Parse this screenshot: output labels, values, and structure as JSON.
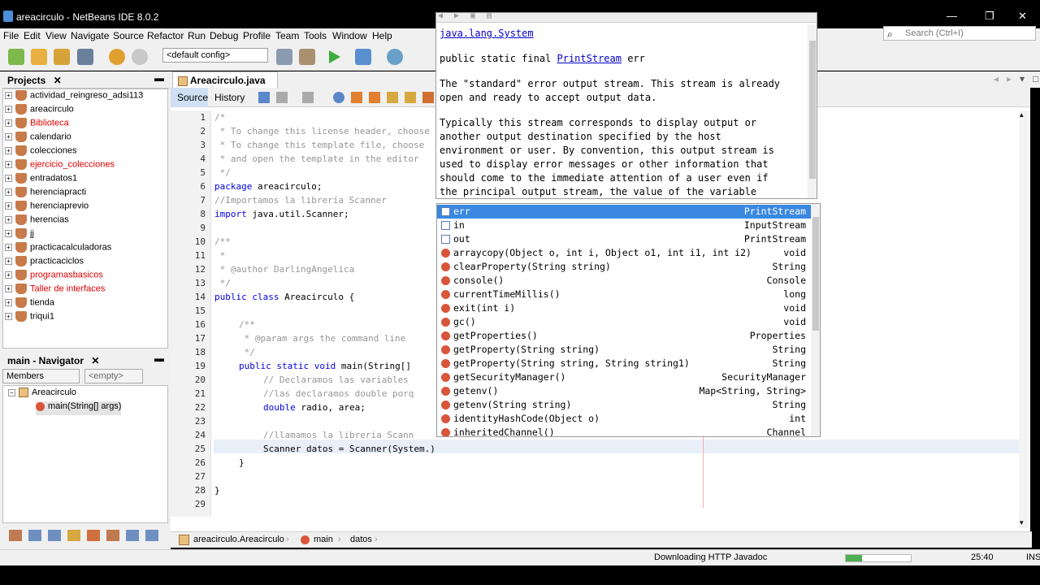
{
  "window": {
    "title": "areacirculo - NetBeans IDE 8.0.2"
  },
  "menu": [
    "File",
    "Edit",
    "View",
    "Navigate",
    "Source",
    "Refactor",
    "Run",
    "Debug",
    "Profile",
    "Team",
    "Tools",
    "Window",
    "Help"
  ],
  "toolbar": {
    "config": "<default config>",
    "search_placeholder": "Search (Ctrl+I)"
  },
  "projects": {
    "title": "Projects",
    "items": [
      {
        "label": "actividad_reingreso_adsi113",
        "error": false
      },
      {
        "label": "areacirculo",
        "error": false
      },
      {
        "label": "Biblioteca",
        "error": true
      },
      {
        "label": "calendario",
        "error": false
      },
      {
        "label": "colecciones",
        "error": false
      },
      {
        "label": "ejercicio_colecciones",
        "error": true
      },
      {
        "label": "entradatos1",
        "error": false
      },
      {
        "label": "herenciapracti",
        "error": false
      },
      {
        "label": "herenciaprevio",
        "error": false
      },
      {
        "label": "herencias",
        "error": false
      },
      {
        "label": "jj",
        "error": false
      },
      {
        "label": "practicacalculadoras",
        "error": false
      },
      {
        "label": "practicaciclos",
        "error": false
      },
      {
        "label": "programasbasicos",
        "error": true
      },
      {
        "label": "Taller de interfaces",
        "error": true
      },
      {
        "label": "tienda",
        "error": false
      },
      {
        "label": "triqui1",
        "error": false
      }
    ]
  },
  "navigator": {
    "title": "main - Navigator",
    "filter": "Members",
    "empty": "<empty>",
    "class": "Areacirculo",
    "method": "main(String[] args)"
  },
  "editor": {
    "tab": "Areacirculo.java",
    "source": "Source",
    "history": "History",
    "lines": [
      {
        "n": "1",
        "text": "/*",
        "cls": "cm",
        "indent": 0
      },
      {
        "n": "2",
        "text": " * To change this license header, choose",
        "cls": "cm",
        "indent": 0
      },
      {
        "n": "3",
        "text": " * To change this template file, choose",
        "cls": "cm",
        "indent": 0
      },
      {
        "n": "4",
        "text": " * and open the template in the editor",
        "cls": "cm",
        "indent": 0
      },
      {
        "n": "5",
        "text": " */",
        "cls": "cm",
        "indent": 0
      },
      {
        "n": "6",
        "text": "package areacirculo;",
        "cls": "",
        "indent": 0
      },
      {
        "n": "7",
        "text": "//Importamos la librería Scanner",
        "cls": "cm",
        "indent": 0
      },
      {
        "n": "8",
        "text": "import java.util.Scanner;",
        "cls": "",
        "indent": 0
      },
      {
        "n": "9",
        "text": "",
        "cls": "",
        "indent": 0
      },
      {
        "n": "10",
        "text": "/**",
        "cls": "cm",
        "indent": 0
      },
      {
        "n": "11",
        "text": " *",
        "cls": "cm",
        "indent": 0
      },
      {
        "n": "12",
        "text": " * @author DarlingAngelica",
        "cls": "cm",
        "indent": 0
      },
      {
        "n": "13",
        "text": " */",
        "cls": "cm",
        "indent": 0
      },
      {
        "n": "14",
        "text": "public class Areacirculo {",
        "cls": "",
        "indent": 0
      },
      {
        "n": "15",
        "text": "",
        "cls": "",
        "indent": 0
      },
      {
        "n": "16",
        "text": "/**",
        "cls": "cm",
        "indent": 1
      },
      {
        "n": "17",
        "text": " * @param args the command line",
        "cls": "cm",
        "indent": 1
      },
      {
        "n": "18",
        "text": " */",
        "cls": "cm",
        "indent": 1
      },
      {
        "n": "19",
        "text": "public static void main(String[]",
        "cls": "",
        "indent": 1
      },
      {
        "n": "20",
        "text": "// Declaramos las variables",
        "cls": "cm",
        "indent": 2
      },
      {
        "n": "21",
        "text": "//las declaramos double porq",
        "cls": "cm",
        "indent": 2
      },
      {
        "n": "22",
        "text": "double radio, area;",
        "cls": "",
        "indent": 2
      },
      {
        "n": "23",
        "text": "",
        "cls": "",
        "indent": 2
      },
      {
        "n": "24",
        "text": "//llamamos la libreria Scann",
        "cls": "cm",
        "indent": 2
      },
      {
        "n": "25",
        "text": "Scanner datos = Scanner(System.)",
        "cls": "",
        "indent": 2
      },
      {
        "n": "26",
        "text": "}",
        "cls": "",
        "indent": 1
      },
      {
        "n": "27",
        "text": "",
        "cls": "",
        "indent": 0
      },
      {
        "n": "28",
        "text": "}",
        "cls": "",
        "indent": 0
      },
      {
        "n": "29",
        "text": "",
        "cls": "",
        "indent": 0
      }
    ]
  },
  "javadoc": {
    "class_link": "java.lang.System",
    "sig_prefix": "public static final ",
    "sig_link": "PrintStream",
    "sig_suffix": " err",
    "para1": [
      "The \"standard\" error output stream. This stream is already",
      "open and ready to accept output data."
    ],
    "para2": [
      "Typically this stream corresponds to display output or",
      "another output destination specified by the host",
      "environment or user. By convention, this output stream is",
      "used to display error messages or other information that",
      "should come to the immediate attention of a user even if",
      "the principal output stream, the value of the variable"
    ]
  },
  "completion": [
    {
      "name": "err",
      "type": "PrintStream",
      "kind": "field",
      "selected": true
    },
    {
      "name": "in",
      "type": "InputStream",
      "kind": "field",
      "selected": false
    },
    {
      "name": "out",
      "type": "PrintStream",
      "kind": "field",
      "selected": false
    },
    {
      "name": "arraycopy(Object o, int i, Object o1, int i1, int i2)",
      "type": "void",
      "kind": "method",
      "selected": false
    },
    {
      "name": "clearProperty(String string)",
      "type": "String",
      "kind": "method",
      "selected": false
    },
    {
      "name": "console()",
      "type": "Console",
      "kind": "method",
      "selected": false
    },
    {
      "name": "currentTimeMillis()",
      "type": "long",
      "kind": "method",
      "selected": false
    },
    {
      "name": "exit(int i)",
      "type": "void",
      "kind": "method",
      "selected": false
    },
    {
      "name": "gc()",
      "type": "void",
      "kind": "method",
      "selected": false
    },
    {
      "name": "getProperties()",
      "type": "Properties",
      "kind": "method",
      "selected": false
    },
    {
      "name": "getProperty(String string)",
      "type": "String",
      "kind": "method",
      "selected": false
    },
    {
      "name": "getProperty(String string, String string1)",
      "type": "String",
      "kind": "method",
      "selected": false
    },
    {
      "name": "getSecurityManager()",
      "type": "SecurityManager",
      "kind": "method",
      "selected": false
    },
    {
      "name": "getenv()",
      "type": "Map<String, String>",
      "kind": "method",
      "selected": false
    },
    {
      "name": "getenv(String string)",
      "type": "String",
      "kind": "method",
      "selected": false
    },
    {
      "name": "identityHashCode(Object o)",
      "type": "int",
      "kind": "method",
      "selected": false
    },
    {
      "name": "inheritedChannel()",
      "type": "Channel",
      "kind": "method",
      "selected": false
    }
  ],
  "breadcrumb": [
    "areacirculo.Areacirculo",
    "main",
    "datos"
  ],
  "status": {
    "task": "Downloading HTTP Javadoc",
    "progress": 0.25,
    "position": "25:40",
    "mode": "INS"
  }
}
